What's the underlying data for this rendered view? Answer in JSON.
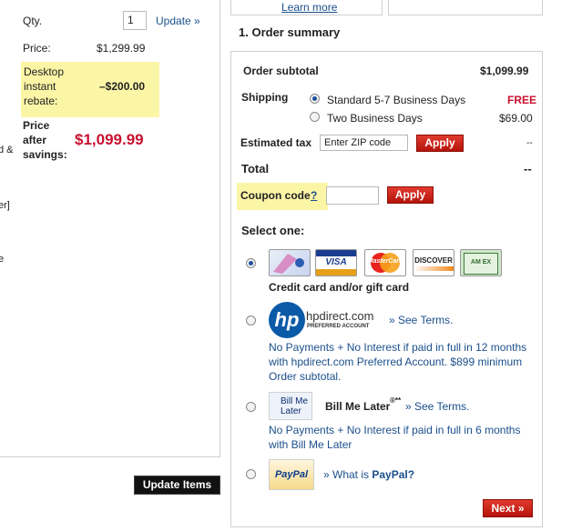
{
  "left": {
    "qty_label": "Qty.",
    "qty_value": "1",
    "update_link": "Update »",
    "price_label": "Price:",
    "price_value": "$1,299.99",
    "rebate_label": "Desktop instant rebate:",
    "rebate_value": "–$200.00",
    "after_label": "Price after savings:",
    "after_value": "$1,099.99",
    "edge_text_1": "d &",
    "edge_text_2": "er]",
    "edge_text_3": "e",
    "update_items_button": "Update Items"
  },
  "top": {
    "learn_more": "Learn more"
  },
  "summary": {
    "section_title": "1. Order summary",
    "subtotal_label": "Order subtotal",
    "subtotal_value": "$1,099.99",
    "shipping_label": "Shipping",
    "shipping_options": [
      {
        "label": "Standard 5-7 Business Days",
        "price": "FREE",
        "selected": true
      },
      {
        "label": "Two Business Days",
        "price": "$69.00",
        "selected": false
      }
    ],
    "tax_label": "Estimated tax",
    "zip_placeholder": "Enter ZIP code",
    "apply_label": "Apply",
    "tax_value": "--",
    "total_label": "Total",
    "total_value": "--",
    "coupon_label": "Coupon code",
    "coupon_help": "?",
    "coupon_apply": "Apply",
    "select_one": "Select one:",
    "cards_caption": "Credit card and/or gift card",
    "hp_logo_text": "hp",
    "hp_site": "hpdirect.com",
    "hp_sub": "PREFERRED ACCOUNT",
    "hp_see_terms": "» See Terms.",
    "hp_desc": "No Payments + No Interest if paid in full in 12 months with hpdirect.com Preferred Account. $899 minimum Order subtotal.",
    "bml_logo": "Bill Me Later",
    "bml_name": "Bill Me Later",
    "bml_mark": "®**",
    "bml_see_terms": "» See Terms.",
    "bml_desc": "No Payments + No Interest if paid in full in 6 months with Bill Me Later",
    "paypal_logo": "PayPal",
    "paypal_q_prefix": "» What is ",
    "paypal_q_name": "PayPal?",
    "next_button": "Next »",
    "card_logos": {
      "visa": "VISA",
      "mastercard": "MasterCard",
      "discover": "DISCOVER",
      "amex": "AM EX"
    }
  }
}
